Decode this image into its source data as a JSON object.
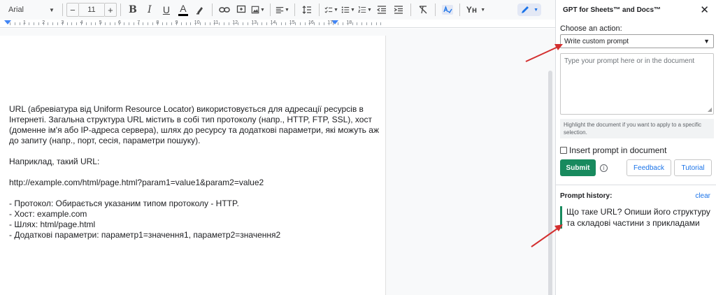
{
  "toolbar": {
    "font": "Arial",
    "font_size": "11",
    "minus": "−",
    "plus": "+",
    "bold": "B",
    "italic": "I",
    "underline": "U",
    "text_color": "A",
    "yh": "Yн"
  },
  "ruler": {
    "numbers": [
      "1",
      "2",
      "3",
      "4",
      "5",
      "6",
      "7",
      "8",
      "9",
      "10",
      "11",
      "12",
      "13",
      "14",
      "15",
      "16",
      "17",
      "18"
    ]
  },
  "document": {
    "paragraphs": [
      "URL (абревіатура від Uniform Resource Locator) використовується для адресації ресурсів в Інтернеті. Загальна структура URL містить в собі тип протоколу (напр., HTTP, FTP, SSL), хост (доменне ім'я або IP-адреса сервера), шлях до ресурсу та додаткові параметри, які можуть аж до запиту (напр., порт, сесія, параметри пошуку).",
      "Наприклад, такий URL:",
      "http://example.com/html/page.html?param1=value1&param2=value2",
      "- Протокол: Обирається указаним типом протоколу - HTTP.\n- Хост: example.com\n- Шлях: html/page.html\n- Додаткові параметри: параметр1=значення1, параметр2=значення2"
    ]
  },
  "sidebar": {
    "title": "GPT for Sheets™ and Docs™",
    "close": "✕",
    "action_label": "Choose an action:",
    "action_selected": "Write custom prompt",
    "prompt_placeholder": "Type your prompt here or in the document",
    "hint": "Highlight the document if you want to apply to a specific selection.",
    "insert_label": "Insert prompt in document",
    "submit": "Submit",
    "feedback": "Feedback",
    "tutorial": "Tutorial",
    "history_label": "Prompt history:",
    "clear": "clear",
    "history_items": [
      "Що таке URL? Опиши його структуру та складові частини з прикладами"
    ]
  },
  "colors": {
    "accent_green": "#188a5e",
    "link_blue": "#1a73e8",
    "arrow_red": "#d32f2f"
  }
}
